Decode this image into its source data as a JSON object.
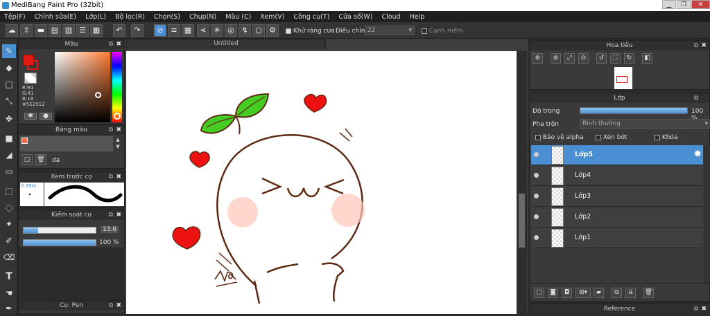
{
  "window": {
    "title": "MediBang Paint Pro (32bit)",
    "min": "▁",
    "max": "❐",
    "close": "✕"
  },
  "menu": [
    "Tệp(F)",
    "Chỉnh sửa(E)",
    "Lớp(L)",
    "Bộ lọc(R)",
    "Chọn(S)",
    "Chụp(N)",
    "Màu (C)",
    "Xem(V)",
    "Công cụ(T)",
    "Cửa sổ(W)",
    "Cloud",
    "Help"
  ],
  "toolbar": {
    "antialias": "Khử răng cưa",
    "correction_label": "Điều chỉnh",
    "correction_value": "22",
    "smooth": "Cạnh mềm"
  },
  "color_panel": {
    "title": "Màu",
    "r": "R:94",
    "g": "G:41",
    "b": "B:18",
    "hex": "#5E2912"
  },
  "palette_panel": {
    "title": "Bảng màu",
    "item": "da"
  },
  "brush_preview": {
    "title": "Xem trước cọ",
    "size": "0.99m"
  },
  "brush_control": {
    "title": "Kiểm soát cọ",
    "size_value": "13.6",
    "opacity_value": "100 %",
    "size_fraction": 0.2,
    "opacity_fraction": 1.0
  },
  "brush_panel": {
    "title": "Cọ: Pen"
  },
  "canvas": {
    "tab": "Untitled"
  },
  "navigator": {
    "title": "Hoa tiêu"
  },
  "layers_panel": {
    "title": "Lớp",
    "opacity_label": "Độ trong",
    "opacity_value": "100 %",
    "blend_label": "Pha trộn",
    "blend_value": "Bình thường",
    "protect_alpha": "Bảo vệ alpha",
    "clipping": "Xén bớt",
    "lock": "Khóa",
    "layers": [
      "Lớp5",
      "Lớp4",
      "Lớp3",
      "Lớp2",
      "Lớp1"
    ]
  },
  "reference_panel": {
    "title": "Reference"
  },
  "colors": {
    "accent": "#4a8fd4",
    "foreground": "#e01b14",
    "leaf": "#44cc22",
    "heart": "#ee1111",
    "outline": "#5e2912"
  }
}
